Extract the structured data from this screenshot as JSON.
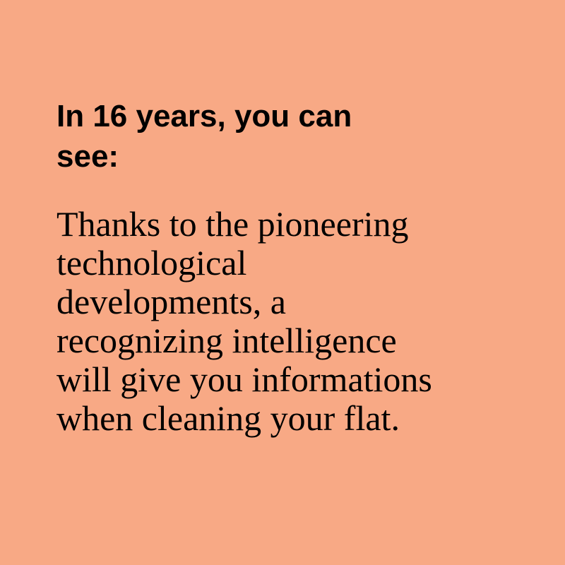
{
  "colors": {
    "background": "#f8a985",
    "text": "#000000"
  },
  "card": {
    "heading": "In 16 years, you can\nsee:",
    "body": "Thanks to the pioneering\ntechnological\ndevelopments, a\nrecognizing intelligence\nwill give you informations\nwhen cleaning your flat."
  }
}
